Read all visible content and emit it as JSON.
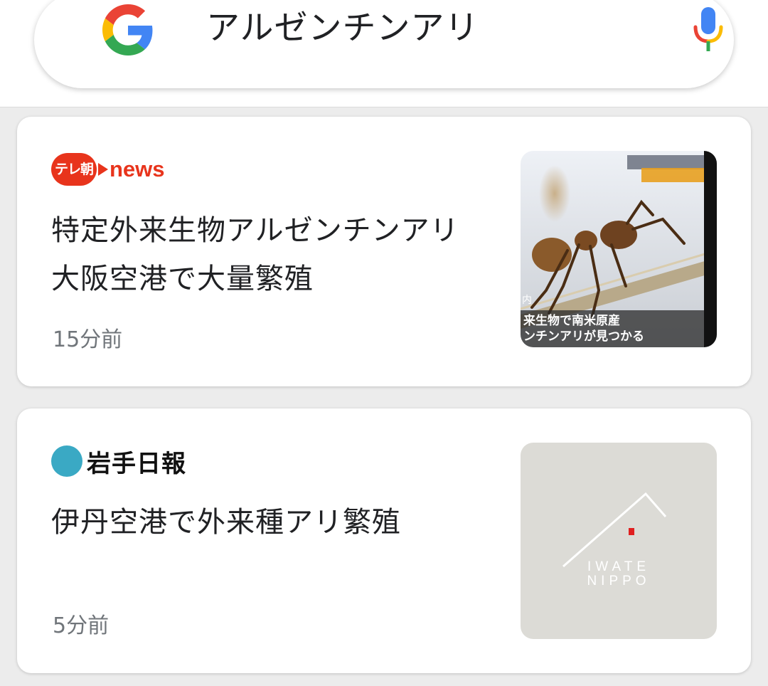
{
  "search": {
    "query": "アルゼンチンアリ",
    "logo_icon": "google-g-icon",
    "voice_icon": "microphone-icon"
  },
  "articles": [
    {
      "source": {
        "badge": "テレ朝",
        "word": "news",
        "color": "#e8341c"
      },
      "headline": "特定外来生物アルゼンチンアリ 大阪空港で大量繁殖",
      "time": "15分前",
      "thumbnail": {
        "description_icon": "ant-photo-icon",
        "caption_line1": "来生物で南米原産",
        "caption_line2": "ンチンアリが見つかる",
        "corner_label": "内"
      }
    },
    {
      "source": {
        "name": "岩手日報",
        "color": "#3aa9c4"
      },
      "headline": "伊丹空港で外来種アリ繁殖",
      "time": "5分前",
      "thumbnail": {
        "line1": "IWATE",
        "line2": "NIPPO",
        "bg_color": "#dcdbd6"
      }
    }
  ]
}
